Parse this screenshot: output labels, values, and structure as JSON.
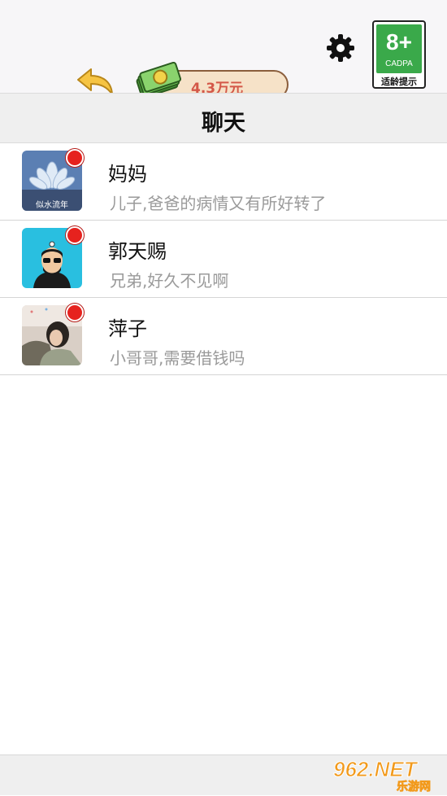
{
  "header": {
    "coins_label": "4.3万元",
    "age_rating": {
      "number": "8+",
      "org": "CADPA",
      "tip": "适龄提示"
    }
  },
  "title": "聊天",
  "chats": [
    {
      "name": "妈妈",
      "message": "儿子,爸爸的病情又有所好转了",
      "avatar_caption": "似水流年",
      "unread": true
    },
    {
      "name": "郭天赐",
      "message": "兄弟,好久不见啊",
      "unread": true
    },
    {
      "name": "萍子",
      "message": "小哥哥,需要借钱吗",
      "unread": true
    }
  ],
  "watermark": {
    "brand": "962.NET",
    "sub": "乐游网"
  },
  "colors": {
    "badge_red": "#e6221e",
    "pill_bg": "#f6e2c8",
    "money_text": "#d45848",
    "age_green": "#3aa94a"
  }
}
